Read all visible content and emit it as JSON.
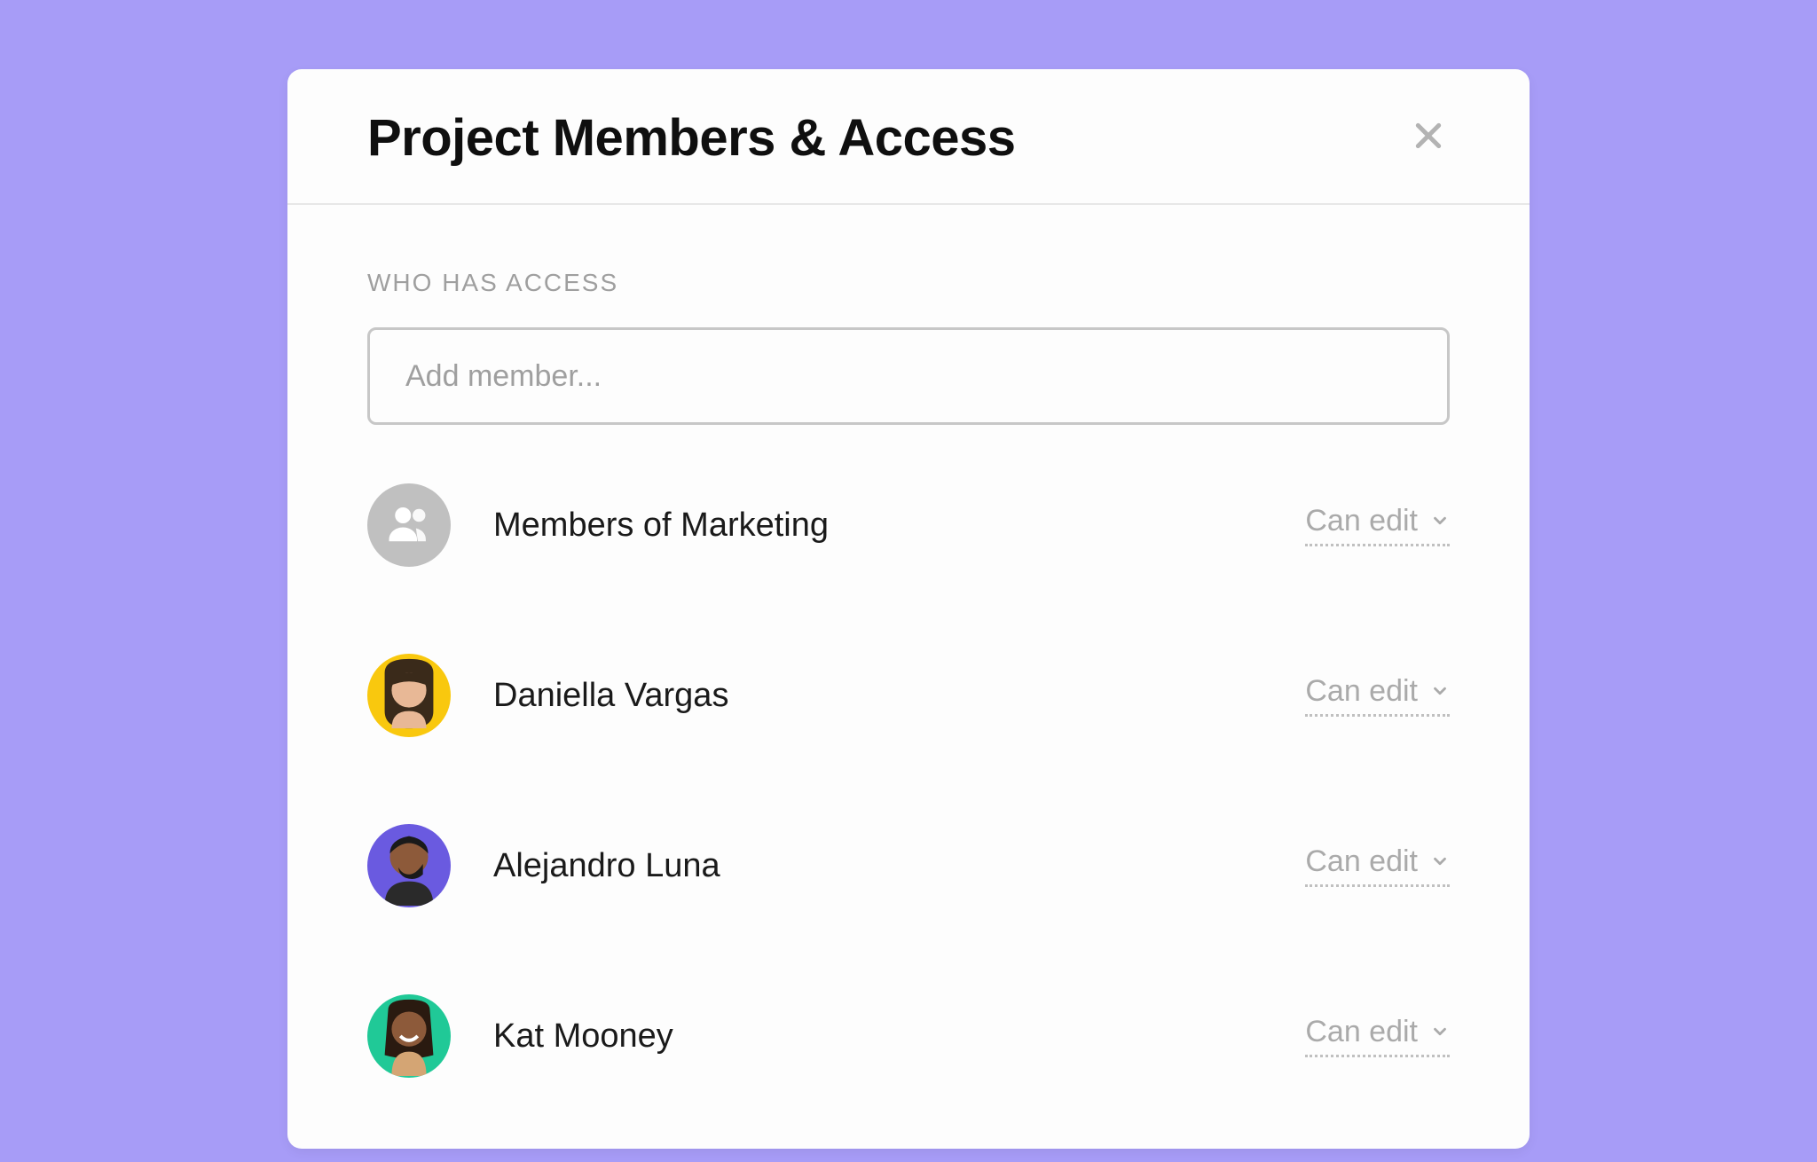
{
  "modal": {
    "title": "Project Members & Access",
    "section_label": "Who has access",
    "add_placeholder": "Add member..."
  },
  "members": [
    {
      "name": "Members of Marketing",
      "permission": "Can edit",
      "avatar_type": "group",
      "avatar_color": "#c0c0c0"
    },
    {
      "name": "Daniella Vargas",
      "permission": "Can edit",
      "avatar_type": "person",
      "avatar_color": "#f9c80e"
    },
    {
      "name": "Alejandro Luna",
      "permission": "Can edit",
      "avatar_type": "person",
      "avatar_color": "#6a5ae0"
    },
    {
      "name": "Kat Mooney",
      "permission": "Can edit",
      "avatar_type": "person",
      "avatar_color": "#20c997"
    }
  ]
}
